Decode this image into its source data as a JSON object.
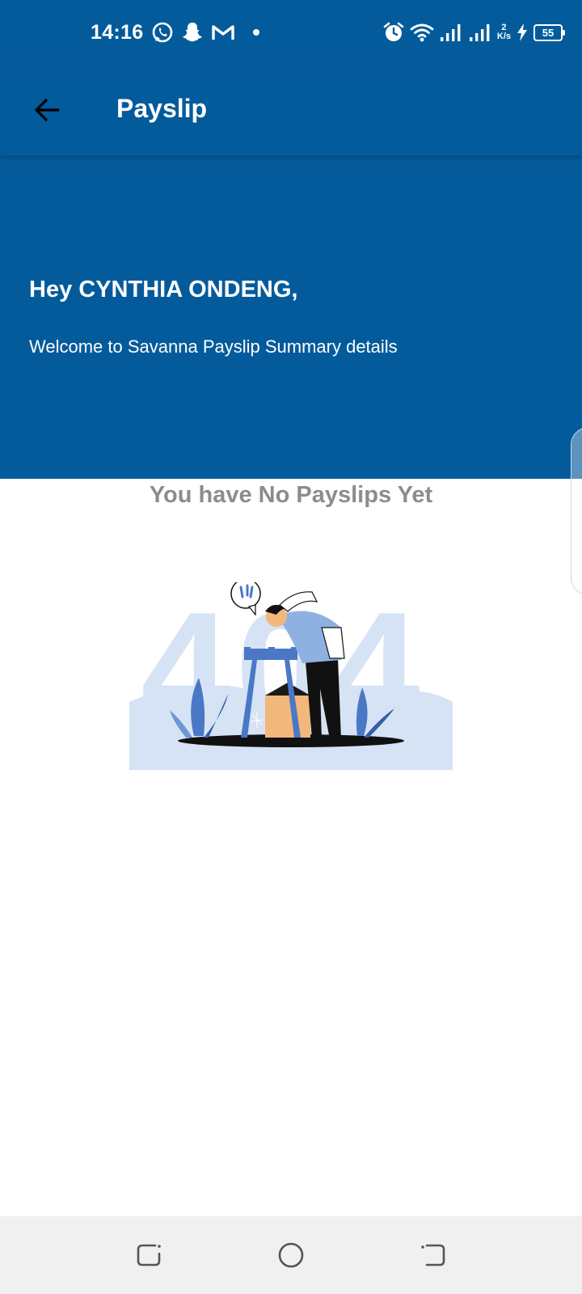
{
  "status_bar": {
    "time": "14:16",
    "net_speed_value": "2",
    "net_speed_unit": "K/s",
    "battery_level": "55",
    "left_icons": [
      "whatsapp-icon",
      "snapchat-icon",
      "gmail-icon",
      "dot-icon"
    ],
    "right_icons": [
      "alarm-icon",
      "wifi-icon",
      "signal-icon",
      "signal-icon",
      "charging-icon",
      "battery-icon"
    ]
  },
  "app_bar": {
    "title": "Payslip",
    "back_icon": "arrow-left-icon"
  },
  "banner": {
    "greeting": "Hey CYNTHIA ONDENG,",
    "welcome": "Welcome to Savanna Payslip Summary details"
  },
  "empty_state": {
    "title": "You have No Payslips Yet",
    "illustration_text": "404"
  },
  "nav_bar": {
    "icons": [
      "recent-apps-icon",
      "home-icon",
      "back-icon"
    ]
  },
  "colors": {
    "primary": "#045b9c",
    "empty_text": "#8c8c8c",
    "illustration_light": "#d6e3f4",
    "illustration_accent": "#4a78c5",
    "nav_bg": "#f0f0f0"
  }
}
